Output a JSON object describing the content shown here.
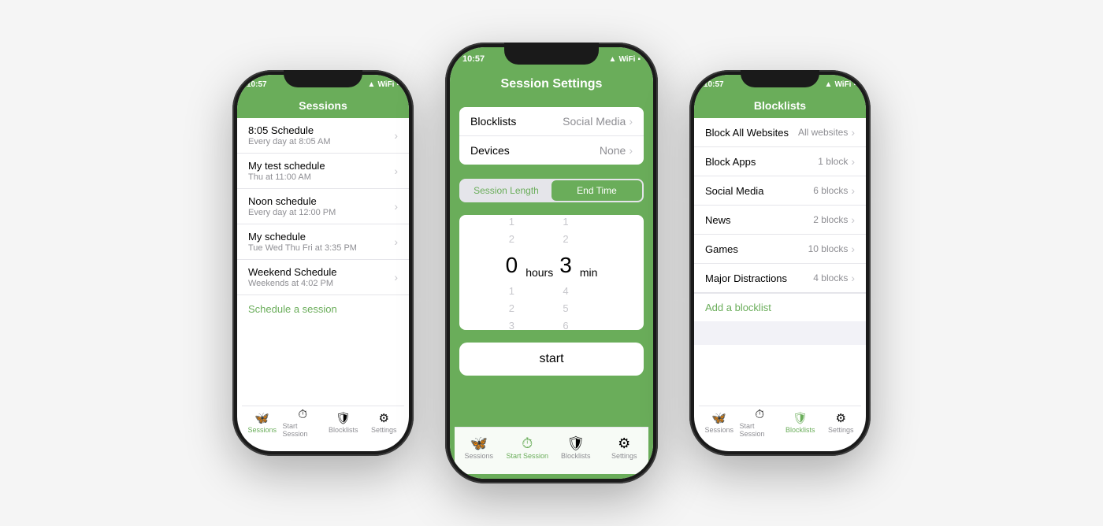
{
  "phones": {
    "phone1": {
      "statusBar": {
        "time": "10:57",
        "signal": "▲",
        "wifi": "WiFi",
        "battery": "■"
      },
      "header": "Sessions",
      "sessions": [
        {
          "title": "8:05 Schedule",
          "subtitle": "Every day at 8:05 AM"
        },
        {
          "title": "My test schedule",
          "subtitle": "Thu at 11:00 AM"
        },
        {
          "title": "Noon schedule",
          "subtitle": "Every day at 12:00 PM"
        },
        {
          "title": "My schedule",
          "subtitle": "Tue Wed Thu Fri at 3:35 PM"
        },
        {
          "title": "Weekend Schedule",
          "subtitle": "Weekends at 4:02 PM"
        }
      ],
      "scheduleLink": "Schedule a session",
      "tabs": [
        {
          "label": "Sessions",
          "active": true
        },
        {
          "label": "Start Session",
          "active": false
        },
        {
          "label": "Blocklists",
          "active": false
        },
        {
          "label": "Settings",
          "active": false
        }
      ]
    },
    "phone2": {
      "statusBar": {
        "time": "10:57",
        "signal": "▲",
        "wifi": "WiFi",
        "battery": "■"
      },
      "header": "Session Settings",
      "rows": [
        {
          "label": "Blocklists",
          "value": "Social Media"
        },
        {
          "label": "Devices",
          "value": "None"
        }
      ],
      "toggles": [
        {
          "label": "Session Length",
          "active": false
        },
        {
          "label": "End Time",
          "active": true
        }
      ],
      "picker": {
        "hoursAbove": [
          "",
          "1",
          "2"
        ],
        "hoursSelected": "0",
        "hoursBelow": [
          "1",
          "2",
          "3"
        ],
        "hoursLabel": "hours",
        "minsAbove": [
          "",
          "1",
          "2"
        ],
        "minsSelected": "3",
        "minsBelow": [
          "4",
          "5",
          "6"
        ],
        "minsLabel": "min"
      },
      "startButton": "start",
      "tabs": [
        {
          "label": "Sessions",
          "active": false
        },
        {
          "label": "Start Session",
          "active": true
        },
        {
          "label": "Blocklists",
          "active": false
        },
        {
          "label": "Settings",
          "active": false
        }
      ]
    },
    "phone3": {
      "statusBar": {
        "time": "10:57",
        "signal": "▲",
        "wifi": "WiFi",
        "battery": "■"
      },
      "header": "Blocklists",
      "items": [
        {
          "label": "Block All Websites",
          "value": "All websites"
        },
        {
          "label": "Block Apps",
          "value": "1 block"
        },
        {
          "label": "Social Media",
          "value": "6 blocks"
        },
        {
          "label": "News",
          "value": "2 blocks"
        },
        {
          "label": "Games",
          "value": "10 blocks"
        },
        {
          "label": "Major Distractions",
          "value": "4 blocks"
        }
      ],
      "addLink": "Add a blocklist",
      "tabs": [
        {
          "label": "Sessions",
          "active": false
        },
        {
          "label": "Start Session",
          "active": false
        },
        {
          "label": "Blocklists",
          "active": true
        },
        {
          "label": "Settings",
          "active": false
        }
      ]
    }
  },
  "colors": {
    "green": "#6aad5a",
    "lightGreen": "#e8f5e3",
    "gray": "#f2f2f7",
    "border": "#e5e5ea",
    "textSecondary": "#8e8e93"
  }
}
